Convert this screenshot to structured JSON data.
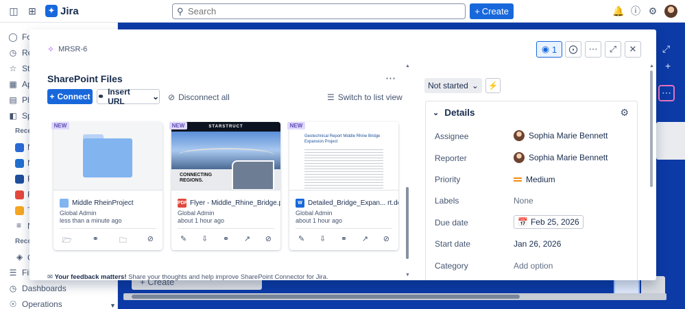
{
  "topnav": {
    "app_name": "Jira",
    "search_placeholder": "Search",
    "create_label": "Create"
  },
  "sidebar": {
    "items": [
      {
        "label": "Fo",
        "icon": "person-icon"
      },
      {
        "label": "Re",
        "icon": "clock-icon"
      },
      {
        "label": "Sta",
        "icon": "star-icon"
      },
      {
        "label": "Ap",
        "icon": "apps-icon"
      },
      {
        "label": "Pla",
        "icon": "plans-icon"
      },
      {
        "label": "Sp",
        "icon": "spaces-icon"
      }
    ],
    "recent_header": "Recen",
    "recent_items": [
      {
        "label": "N",
        "color": "#2a6ad6"
      },
      {
        "label": "N",
        "color": "#1f6fd0"
      },
      {
        "label": "F",
        "color": "#1d4f9c"
      },
      {
        "label": "F",
        "color": "#e2483d"
      },
      {
        "label": "T",
        "color": "#f5a623"
      },
      {
        "label": "N",
        "color": "#44546f"
      }
    ],
    "recent2_header": "Reco",
    "recent2_items": [
      {
        "label": "C"
      }
    ],
    "bottom_items": [
      {
        "label": "Filt",
        "icon": "filter-icon"
      },
      {
        "label": "Dashboards",
        "icon": "dashboard-icon"
      },
      {
        "label": "Operations",
        "icon": "operations-icon"
      }
    ]
  },
  "board": {
    "create_label": "Create"
  },
  "modal": {
    "issue_key": "MRSR-6",
    "watch_count": "1",
    "sharepoint": {
      "title": "SharePoint Files",
      "connect_label": "Connect",
      "insert_url_label": "Insert URL",
      "disconnect_label": "Disconnect all",
      "switch_view_label": "Switch to list view",
      "cards": [
        {
          "badge": "NEW",
          "name": "Middle RheinProject",
          "author": "Global Admin",
          "time": "less than a minute ago",
          "type": "folder"
        },
        {
          "badge": "NEW",
          "name": "Flyer - Middle_Rhine_Bridge.pdf",
          "author": "Global Admin",
          "time": "about 1 hour ago",
          "type": "pdf",
          "preview_title": "STARSTRUCT",
          "preview_caption": "CONNECTING REGIONS."
        },
        {
          "badge": "NEW",
          "name": "Detailed_Bridge_Expan... rt.docx",
          "author": "Global Admin",
          "time": "about 1 hour ago",
          "type": "docx",
          "preview_title": "Geotechnical Report Middle Rhine Bridge Expansion Project"
        }
      ],
      "feedback_bold": "Your feedback matters!",
      "feedback_text": " Share your thoughts and help improve SharePoint Connector for Jira."
    },
    "status": "Not started",
    "details": {
      "header": "Details",
      "rows": [
        {
          "label": "Assignee",
          "value": "Sophia Marie Bennett"
        },
        {
          "label": "Reporter",
          "value": "Sophia Marie Bennett"
        },
        {
          "label": "Priority",
          "value": "Medium"
        },
        {
          "label": "Labels",
          "value": "None"
        },
        {
          "label": "Due date",
          "value": "Feb 25, 2026"
        },
        {
          "label": "Start date",
          "value": "Jan 26, 2026"
        },
        {
          "label": "Category",
          "value": "Add option"
        }
      ]
    }
  },
  "colors": {
    "brand": "#1868db",
    "board_bg": "#0c3aa6",
    "new_badge": "#dfd8fd",
    "priority_medium": "#f18d13"
  }
}
